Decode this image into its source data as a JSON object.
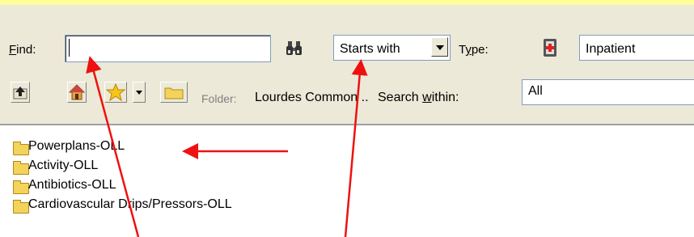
{
  "find": {
    "label": "Find:",
    "underline_char": "F",
    "rest": "ind:",
    "value": ""
  },
  "search_mode": {
    "selected": "Starts with"
  },
  "type": {
    "label_pre": "T",
    "label_u": "y",
    "label_post": "pe:",
    "value": "Inpatient"
  },
  "folder": {
    "label": "Folder:",
    "value": "Lourdes Common ..",
    "search_pre": "Search ",
    "search_u": "w",
    "search_post": "ithin:",
    "within_value": "All"
  },
  "tree": {
    "items": [
      {
        "label": "Powerplans-OLL"
      },
      {
        "label": "Activity-OLL"
      },
      {
        "label": "Antibiotics-OLL"
      },
      {
        "label": "Cardiovascular Drips/Pressors-OLL"
      }
    ]
  },
  "colors": {
    "annotation_arrow": "#ee1111",
    "panel": "#ece9d8",
    "highlight_bar": "#ffff99"
  },
  "icons": [
    "binoculars-icon",
    "medication-type-icon",
    "up-folder-icon",
    "home-icon",
    "favorites-star-icon",
    "folder-icon"
  ]
}
